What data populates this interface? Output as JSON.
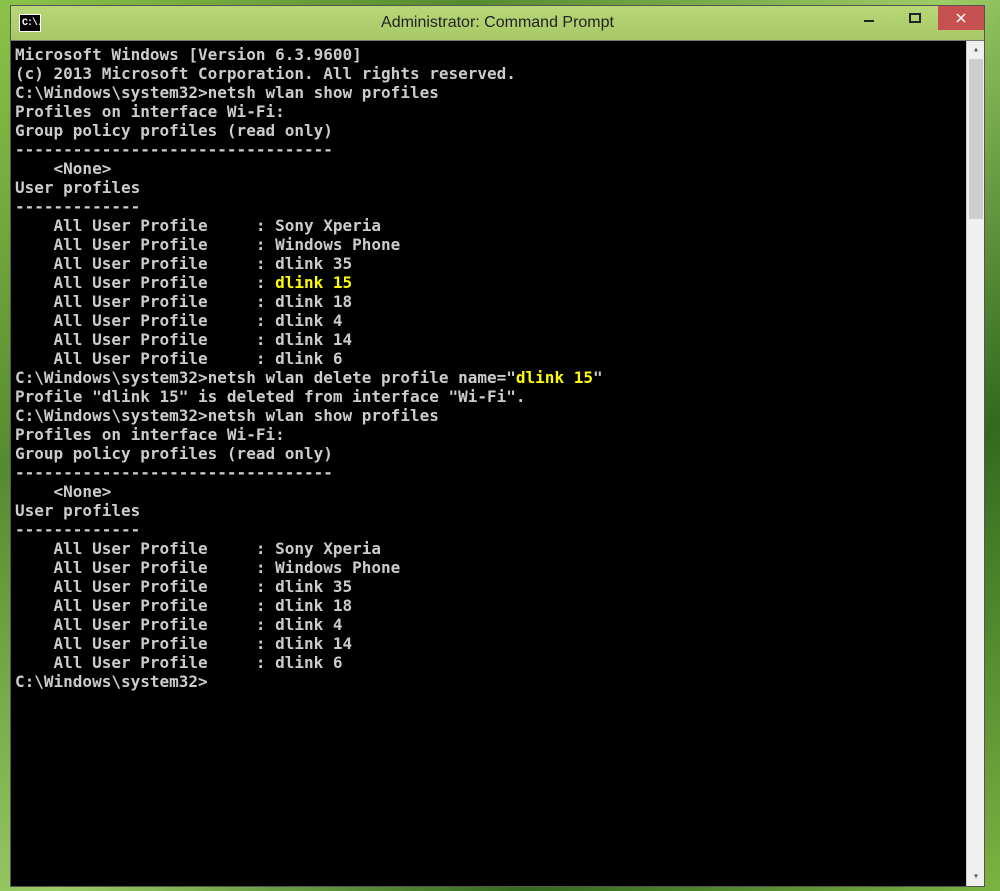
{
  "window": {
    "title": "Administrator: Command Prompt",
    "icon_label": "C:\\."
  },
  "terminal": {
    "header_line1": "Microsoft Windows [Version 6.3.9600]",
    "header_line2": "(c) 2013 Microsoft Corporation. All rights reserved.",
    "prompt": "C:\\Windows\\system32>",
    "cmd_show": "netsh wlan show profiles",
    "cmd_delete_prefix": "netsh wlan delete profile name=\"",
    "delete_target": "dlink 15",
    "cmd_delete_suffix": "\"",
    "delete_result": "Profile \"dlink 15\" is deleted from interface \"Wi-Fi\".",
    "section_interface": "Profiles on interface Wi-Fi:",
    "section_group": "Group policy profiles (read only)",
    "section_group_dash": "---------------------------------",
    "none_value": "    <None>",
    "section_user": "User profiles",
    "section_user_dash": "-------------",
    "profile_label": "    All User Profile     : ",
    "profiles_before": [
      "Sony Xperia",
      "Windows Phone",
      "dlink 35",
      "dlink 15",
      "dlink 18",
      "dlink 4",
      "dlink 14",
      "dlink 6"
    ],
    "profiles_after": [
      "Sony Xperia",
      "Windows Phone",
      "dlink 35",
      "dlink 18",
      "dlink 4",
      "dlink 14",
      "dlink 6"
    ],
    "highlight_profile": "dlink 15"
  }
}
